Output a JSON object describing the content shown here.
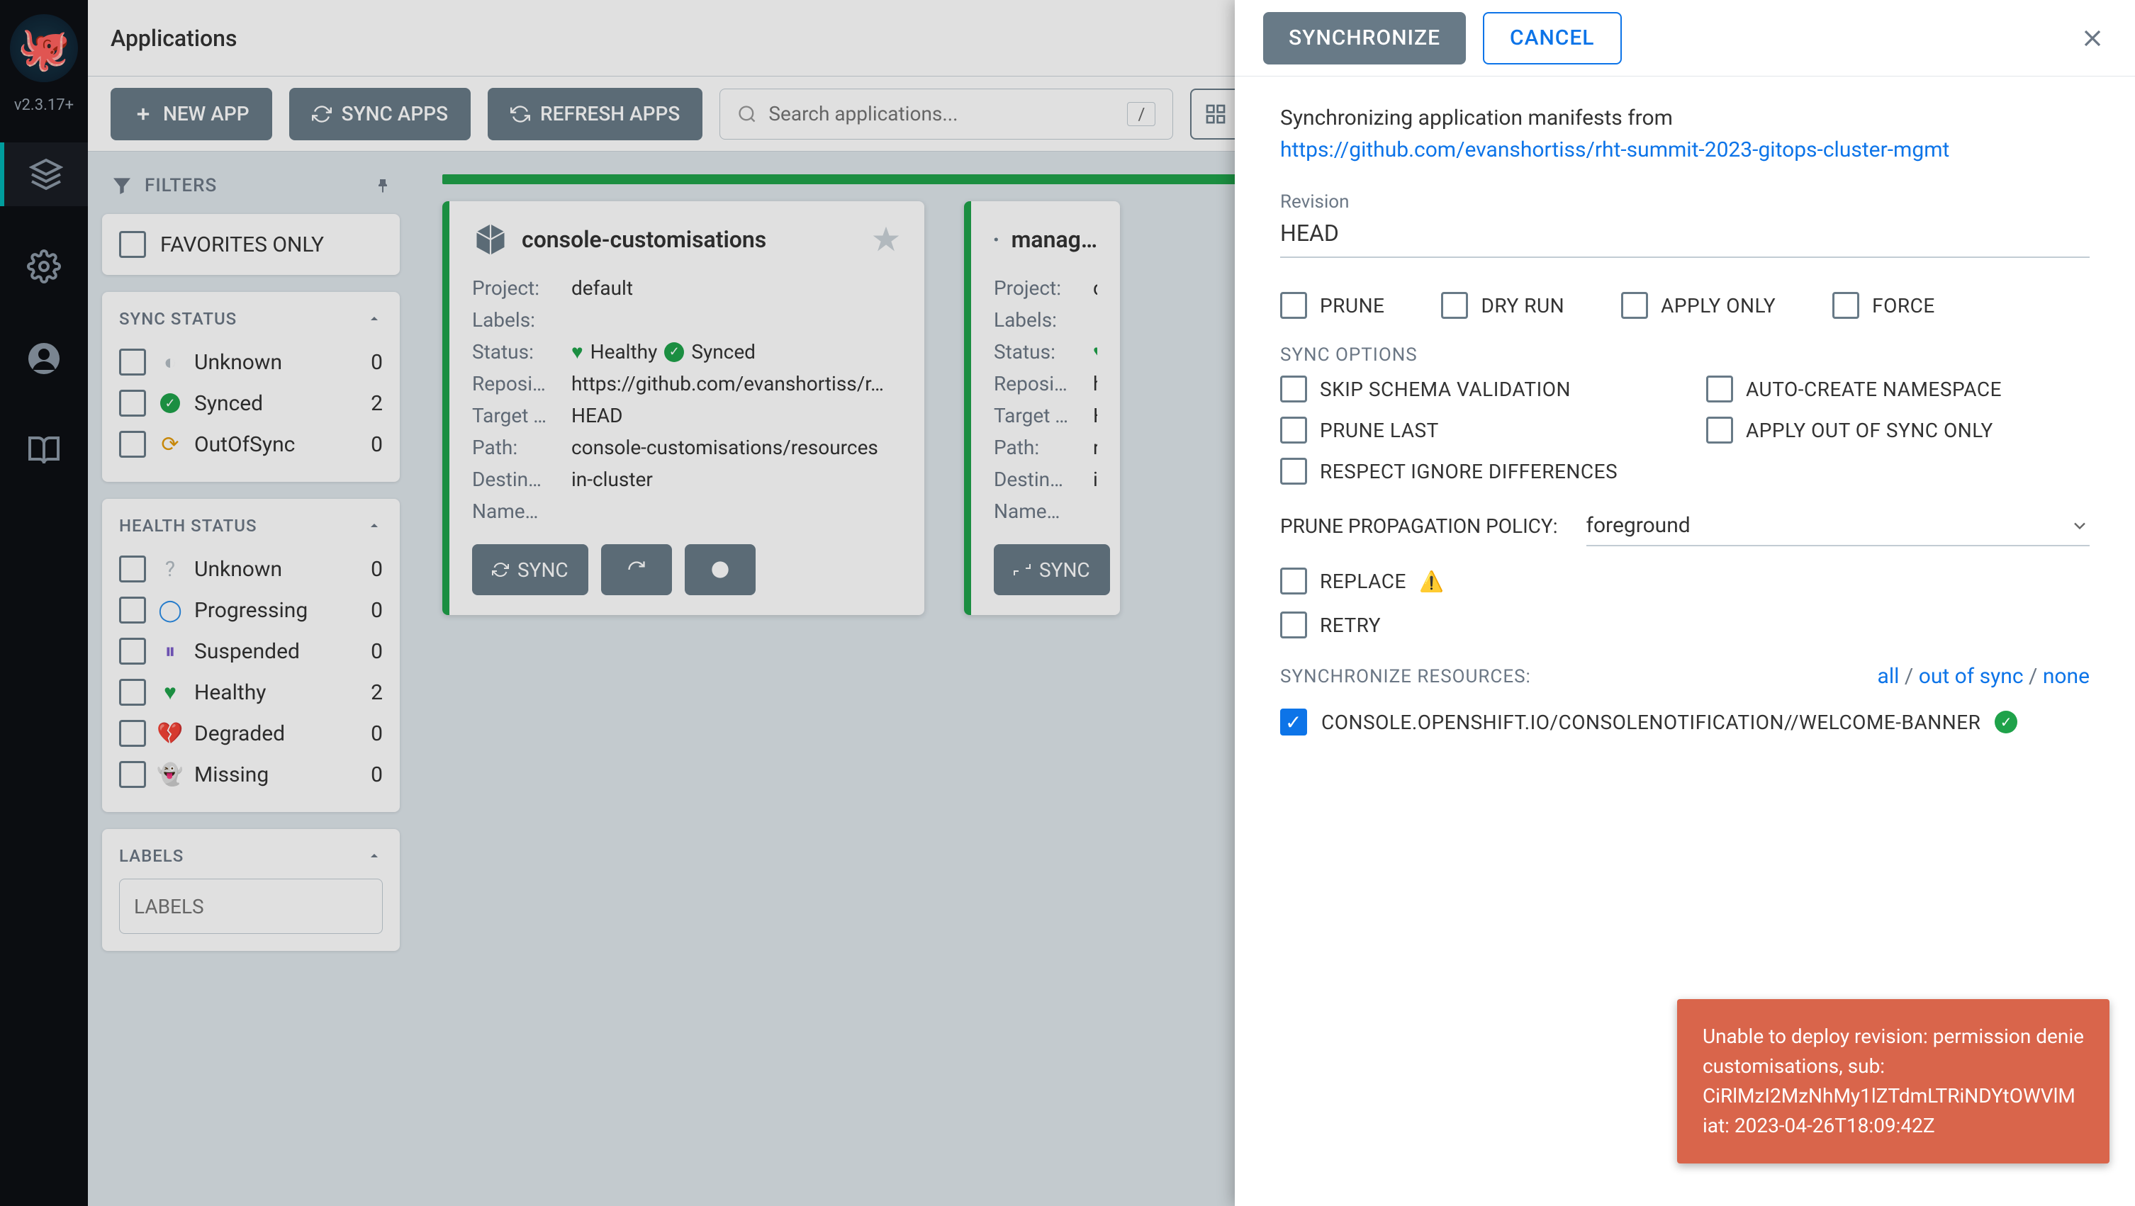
{
  "version": "v2.3.17+",
  "page_title": "Applications",
  "toolbar": {
    "new_app": "NEW APP",
    "sync_apps": "SYNC APPS",
    "refresh_apps": "REFRESH APPS",
    "search_placeholder": "Search applications...",
    "search_kbd": "/"
  },
  "filters": {
    "title": "FILTERS",
    "favorites_label": "FAVORITES ONLY",
    "sync_status": {
      "heading": "SYNC STATUS",
      "items": [
        {
          "label": "Unknown",
          "count": "0"
        },
        {
          "label": "Synced",
          "count": "2"
        },
        {
          "label": "OutOfSync",
          "count": "0"
        }
      ]
    },
    "health_status": {
      "heading": "HEALTH STATUS",
      "items": [
        {
          "label": "Unknown",
          "count": "0"
        },
        {
          "label": "Progressing",
          "count": "0"
        },
        {
          "label": "Suspended",
          "count": "0"
        },
        {
          "label": "Healthy",
          "count": "2"
        },
        {
          "label": "Degraded",
          "count": "0"
        },
        {
          "label": "Missing",
          "count": "0"
        }
      ]
    },
    "labels": {
      "heading": "LABELS",
      "placeholder": "LABELS"
    }
  },
  "apps": [
    {
      "name": "console-customisations",
      "project_k": "Project:",
      "project_v": "default",
      "labels_k": "Labels:",
      "labels_v": "",
      "status_k": "Status:",
      "status_health": "Healthy",
      "status_sync": "Synced",
      "repo_k": "Reposi…",
      "repo_v": "https://github.com/evanshortiss/r…",
      "target_k": "Target …",
      "target_v": "HEAD",
      "path_k": "Path:",
      "path_v": "console-customisations/resources",
      "dest_k": "Destin…",
      "dest_v": "in-cluster",
      "ns_k": "Name…",
      "ns_v": "",
      "sync_btn": "SYNC"
    },
    {
      "name": "manag…",
      "project_k": "Project:",
      "project_v": "d",
      "labels_k": "Labels:",
      "labels_v": "",
      "status_k": "Status:",
      "status_health": "",
      "status_sync": "",
      "repo_k": "Reposi…",
      "repo_v": "h",
      "target_k": "Target …",
      "target_v": "H",
      "path_k": "Path:",
      "path_v": "r",
      "dest_k": "Destin…",
      "dest_v": "i",
      "ns_k": "Name…",
      "ns_v": "",
      "sync_btn": "SYNC"
    }
  ],
  "panel": {
    "synchronize_btn": "SYNCHRONIZE",
    "cancel_btn": "CANCEL",
    "intro_text": "Synchronizing application manifests from ",
    "intro_link": "https://github.com/evanshortiss/rht-summit-2023-gitops-cluster-mgmt",
    "revision_label": "Revision",
    "revision_value": "HEAD",
    "top_opts": {
      "prune": "PRUNE",
      "dry_run": "DRY RUN",
      "apply_only": "APPLY ONLY",
      "force": "FORCE"
    },
    "sync_options_heading": "SYNC OPTIONS",
    "sync_opts": {
      "skip_schema": "SKIP SCHEMA VALIDATION",
      "auto_ns": "AUTO-CREATE NAMESPACE",
      "prune_last": "PRUNE LAST",
      "apply_oos": "APPLY OUT OF SYNC ONLY",
      "respect_ignore": "RESPECT IGNORE DIFFERENCES"
    },
    "policy_label": "PRUNE PROPAGATION POLICY:",
    "policy_value": "foreground",
    "replace_label": "REPLACE",
    "retry_label": "RETRY",
    "sync_resources_heading": "SYNCHRONIZE RESOURCES:",
    "links": {
      "all": "all",
      "out_of_sync": "out of sync",
      "none": "none",
      "sep": " / "
    },
    "resource_name": "CONSOLE.OPENSHIFT.IO/CONSOLENOTIFICATION//WELCOME-BANNER"
  },
  "toast": {
    "line1": "Unable to deploy revision: permission denie",
    "line2": "customisations, sub: ",
    "line3": "CiRlMzI2MzNhMy1lZTdmLTRiNDYtOWVlM",
    "line4": "iat: 2023-04-26T18:09:42Z"
  }
}
